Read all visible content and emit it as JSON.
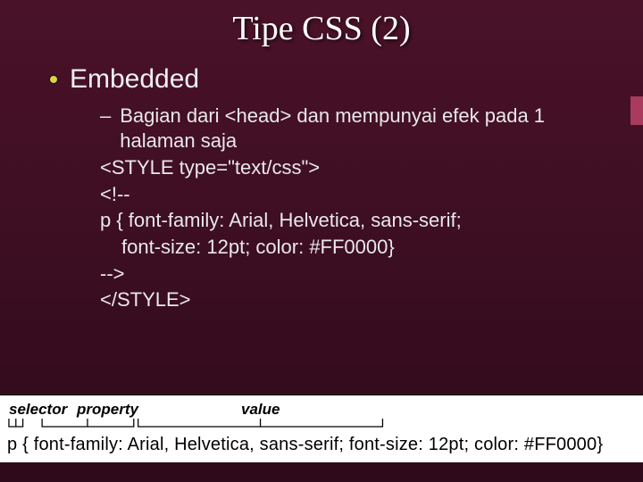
{
  "title": "Tipe CSS (2)",
  "bullet": "Embedded",
  "sub_desc": "Bagian dari <head> dan mempunyai efek pada 1 halaman saja",
  "code": {
    "l1": "<STYLE type=\"text/css\">",
    "l2": "<!--",
    "l3a": "p {  font-family: Arial, Helvetica, sans-serif;",
    "l3b": "font-size: 12pt; color: #FF0000}",
    "l4": "-->",
    "l5": "</STYLE>"
  },
  "diagram": {
    "selector_label": "selector",
    "property_label": "property",
    "value_label": "value",
    "css_line": "p { font-family: Arial, Helvetica, sans-serif; font-size: 12pt; color: #FF0000}"
  }
}
